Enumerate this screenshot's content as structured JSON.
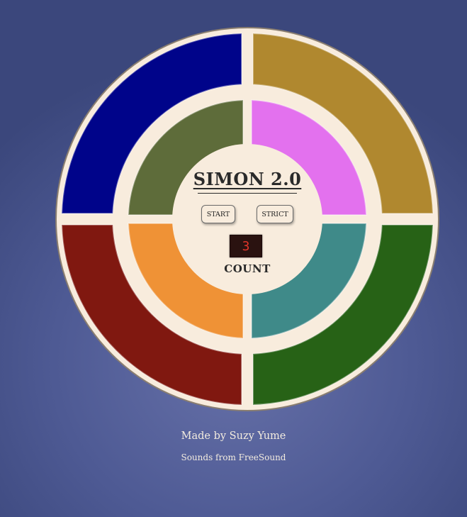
{
  "game": {
    "title": "SIMON 2.0",
    "start_label": "START",
    "strict_label": "STRICT",
    "count_value": "3",
    "count_label": "COUNT"
  },
  "pads": {
    "outer": [
      {
        "name": "outer-pad-blue",
        "color": "#00048a"
      },
      {
        "name": "outer-pad-gold",
        "color": "#b0882f"
      },
      {
        "name": "outer-pad-red",
        "color": "#801810"
      },
      {
        "name": "outer-pad-green",
        "color": "#276216"
      }
    ],
    "inner": [
      {
        "name": "inner-pad-olive",
        "color": "#5e6c3a"
      },
      {
        "name": "inner-pad-pink",
        "color": "#e371ee"
      },
      {
        "name": "inner-pad-orange",
        "color": "#ef9236"
      },
      {
        "name": "inner-pad-teal",
        "color": "#3f8a89"
      }
    ],
    "board_color": "#f8ecdd"
  },
  "footer": {
    "made_by": "Made by Suzy Yume",
    "sounds": "Sounds from FreeSound"
  }
}
